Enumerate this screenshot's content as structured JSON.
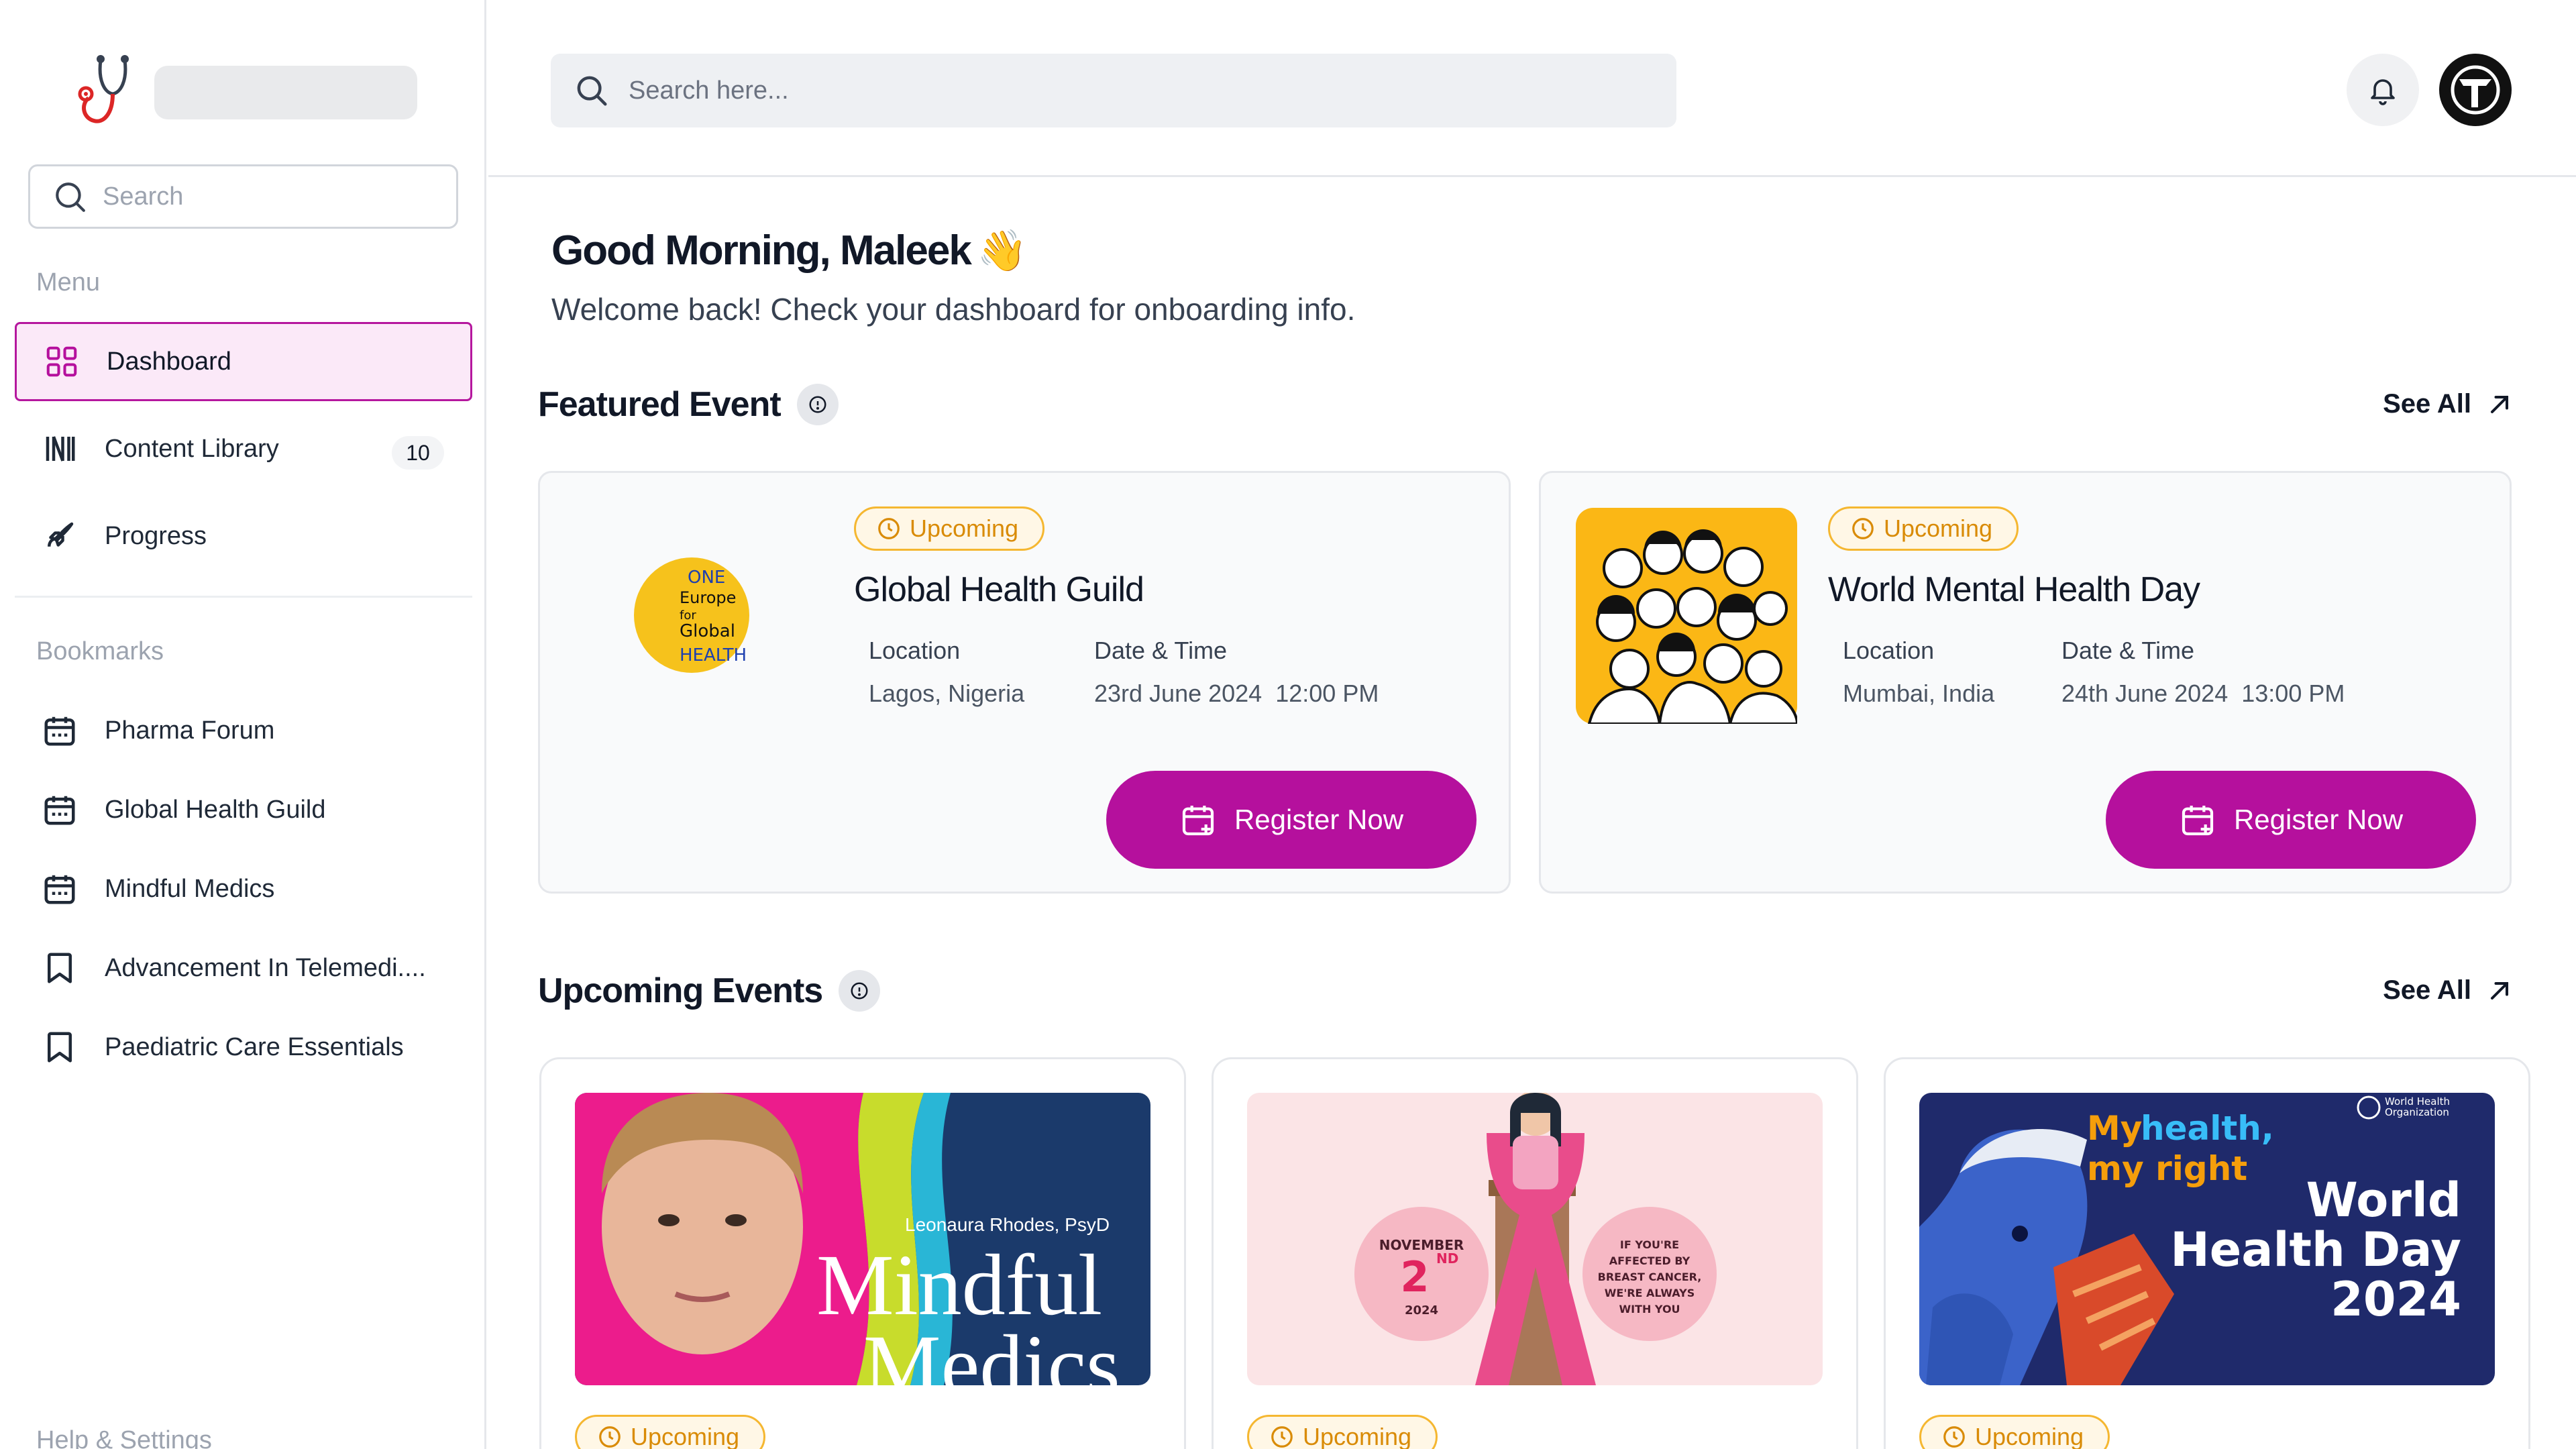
{
  "sidebar": {
    "search_placeholder": "Search",
    "menu_label": "Menu",
    "menu": [
      {
        "label": "Dashboard",
        "icon": "grid-icon",
        "active": true
      },
      {
        "label": "Content Library",
        "icon": "library-icon",
        "badge": "10"
      },
      {
        "label": "Progress",
        "icon": "rocket-icon"
      }
    ],
    "bookmarks_label": "Bookmarks",
    "bookmarks": [
      {
        "label": "Pharma Forum",
        "icon": "calendar-icon"
      },
      {
        "label": "Global Health Guild",
        "icon": "calendar-icon"
      },
      {
        "label": "Mindful Medics",
        "icon": "calendar-icon"
      },
      {
        "label": "Advancement In Telemedi....",
        "icon": "bookmark-icon"
      },
      {
        "label": "Paediatric Care Essentials",
        "icon": "bookmark-icon"
      }
    ],
    "help_label": "Help & Settings"
  },
  "header": {
    "search_placeholder": "Search here...",
    "avatar_letter": "T"
  },
  "main": {
    "greeting": "Good Morning, Maleek",
    "greeting_emoji": "👋",
    "subtitle": "Welcome back! Check your dashboard for onboarding info.",
    "featured": {
      "title": "Featured Event",
      "see_all": "See All",
      "events": [
        {
          "status": "Upcoming",
          "title": "Global Health Guild",
          "location_label": "Location",
          "location": "Lagos, Nigeria",
          "datetime_label": "Date & Time",
          "date": "23rd June 2024",
          "time": "12:00 PM",
          "cta": "Register Now",
          "logo_text": [
            "ONE",
            "Europe",
            "for",
            "Global",
            "HEALTH"
          ]
        },
        {
          "status": "Upcoming",
          "title": "World Mental Health Day",
          "location_label": "Location",
          "location": "Mumbai, India",
          "datetime_label": "Date & Time",
          "date": "24th June 2024",
          "time": "13:00 PM",
          "cta": "Register Now"
        }
      ]
    },
    "upcoming": {
      "title": "Upcoming Events",
      "see_all": "See All",
      "events": [
        {
          "status": "Upcoming",
          "image_caption": "Leonaura Rhodes, PsyD",
          "image_title_1": "Mindful",
          "image_title_2": "Medics"
        },
        {
          "status": "Upcoming",
          "image_date_1": "NOVEMBER",
          "image_date_num": "2",
          "image_date_sup": "ND",
          "image_date_year": "2024",
          "image_quote": [
            "IF YOU'RE",
            "AFFECTED BY",
            "BREAST CANCER,",
            "WE'RE ALWAYS",
            "WITH YOU"
          ]
        },
        {
          "status": "Upcoming",
          "image_tag_1": "My",
          "image_tag_2": "health,",
          "image_tag_3": "my right",
          "image_title_1": "World",
          "image_title_2": "Health Day",
          "image_title_3": "2024",
          "image_org": [
            "World Health",
            "Organization"
          ]
        }
      ]
    }
  },
  "colors": {
    "accent": "#b5109d",
    "accent_light": "#fbe9f8",
    "status": "#d98b06",
    "status_bg": "#fff7e6"
  }
}
